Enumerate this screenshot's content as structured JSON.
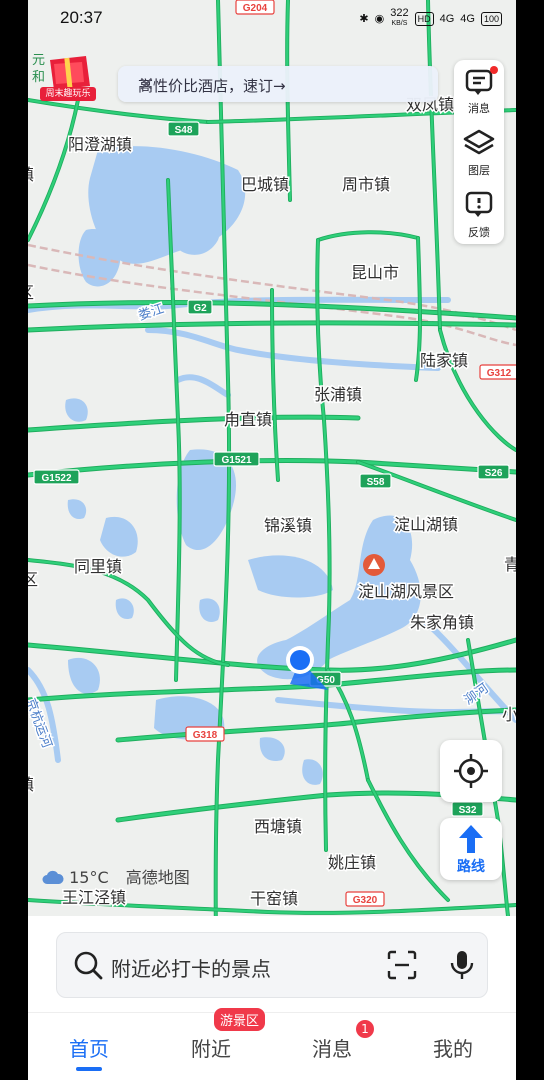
{
  "status_bar": {
    "time": "20:37",
    "net_speed": "322",
    "net_unit": "KB/S",
    "hd": "HD",
    "signal_1": "4G",
    "signal_2": "4G",
    "battery": "100"
  },
  "promo_banner": {
    "text": "高性价比酒店，速订→",
    "close_icon": "close-icon"
  },
  "gift_badge": {
    "label": "周末趣玩乐",
    "edge_text": "元和"
  },
  "side_panel": {
    "items": [
      {
        "label": "消息",
        "icon": "message-icon",
        "has_dot": true
      },
      {
        "label": "图层",
        "icon": "layers-icon"
      },
      {
        "label": "反馈",
        "icon": "feedback-icon"
      }
    ]
  },
  "map": {
    "places": [
      {
        "name": "阳澄湖镇",
        "kind": "town"
      },
      {
        "name": "巴城镇",
        "kind": "town"
      },
      {
        "name": "周市镇",
        "kind": "town"
      },
      {
        "name": "双凤镇",
        "kind": "town"
      },
      {
        "name": "昆山市",
        "kind": "city"
      },
      {
        "name": "陆家镇",
        "kind": "town"
      },
      {
        "name": "张浦镇",
        "kind": "town"
      },
      {
        "name": "甪直镇",
        "kind": "town"
      },
      {
        "name": "锦溪镇",
        "kind": "town"
      },
      {
        "name": "淀山湖镇",
        "kind": "town"
      },
      {
        "name": "同里镇",
        "kind": "town"
      },
      {
        "name": "淀山湖风景区",
        "kind": "poi"
      },
      {
        "name": "朱家角镇",
        "kind": "town"
      },
      {
        "name": "西塘镇",
        "kind": "town"
      },
      {
        "name": "姚庄镇",
        "kind": "town"
      },
      {
        "name": "王江泾镇",
        "kind": "town"
      },
      {
        "name": "干窑镇",
        "kind": "town"
      },
      {
        "name": "娄江",
        "kind": "river"
      },
      {
        "name": "京杭运河",
        "kind": "river"
      },
      {
        "name": "泖河",
        "kind": "river"
      },
      {
        "name": "镇",
        "kind": "edge"
      },
      {
        "name": "区",
        "kind": "edge"
      },
      {
        "name": "区",
        "kind": "edge"
      },
      {
        "name": "镇",
        "kind": "edge"
      },
      {
        "name": "青",
        "kind": "edge"
      },
      {
        "name": "小",
        "kind": "edge"
      }
    ],
    "shields": [
      {
        "code": "S48",
        "type": "provincial"
      },
      {
        "code": "G2",
        "type": "national"
      },
      {
        "code": "G312",
        "type": "national-red"
      },
      {
        "code": "G1521",
        "type": "national"
      },
      {
        "code": "G1522",
        "type": "national"
      },
      {
        "code": "S58",
        "type": "provincial"
      },
      {
        "code": "S26",
        "type": "provincial"
      },
      {
        "code": "G50",
        "type": "national"
      },
      {
        "code": "G318",
        "type": "national-red"
      },
      {
        "code": "S32",
        "type": "provincial"
      },
      {
        "code": "G320",
        "type": "national-red"
      },
      {
        "code": "G204",
        "type": "national-red"
      }
    ],
    "colors": {
      "land": "#eef0ee",
      "water": "#a8cbf2",
      "highway": "#2fcf7a",
      "highway_casing": "#1fae5e",
      "railway": "#d9b8b8",
      "shield_green": "#1ea35a",
      "shield_red": "#e8423e",
      "location_dot": "#1a6ef5"
    }
  },
  "controls": {
    "locate_icon": "locate-icon",
    "route_label": "路线",
    "route_icon": "route-arrow-icon"
  },
  "weather": {
    "icon": "cloud-icon",
    "temperature": "15°C",
    "brand": "高德地图"
  },
  "search": {
    "placeholder": "附近必打卡的景点",
    "search_icon": "search-icon",
    "scan_icon": "scan-icon",
    "mic_icon": "mic-icon"
  },
  "tabs": [
    {
      "label": "首页",
      "active": true
    },
    {
      "label": "附近",
      "badge": "游景区"
    },
    {
      "label": "消息",
      "badge_count": "1"
    },
    {
      "label": "我的"
    }
  ]
}
